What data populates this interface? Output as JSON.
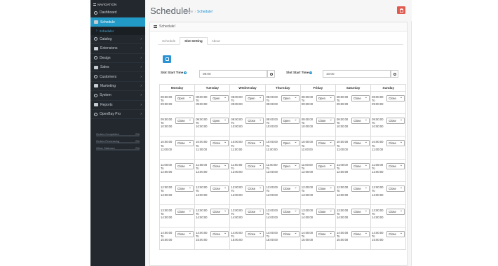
{
  "sidebar": {
    "heading": "NAVIGATION",
    "items": [
      {
        "label": "Dashboard",
        "icon": "dashboard-icon",
        "arrow": ""
      },
      {
        "label": "Schedule",
        "icon": "calendar-icon",
        "arrow": ""
      },
      {
        "label": "Catalog",
        "icon": "tag-icon",
        "arrow": "›"
      },
      {
        "label": "Extensions",
        "icon": "puzzle-icon",
        "arrow": "›"
      },
      {
        "label": "Design",
        "icon": "monitor-icon",
        "arrow": "›"
      },
      {
        "label": "Sales",
        "icon": "cart-icon",
        "arrow": "›"
      },
      {
        "label": "Customers",
        "icon": "user-icon",
        "arrow": "›"
      },
      {
        "label": "Marketing",
        "icon": "share-icon",
        "arrow": "›"
      },
      {
        "label": "System",
        "icon": "gear-icon",
        "arrow": "›"
      },
      {
        "label": "Reports",
        "icon": "chart-icon",
        "arrow": "›"
      },
      {
        "label": "OpenBay Pro",
        "icon": "openbay-icon",
        "arrow": "›"
      }
    ],
    "sub_item": "Schedule!",
    "stats": [
      {
        "label": "Orders Completed",
        "value": "0%"
      },
      {
        "label": "Orders Processing",
        "value": "0%"
      },
      {
        "label": "Other Statuses",
        "value": "0%"
      }
    ]
  },
  "header": {
    "title": "Schedule!",
    "breadcrumb": [
      "Home",
      "Schedule!"
    ],
    "delete_icon": "trash-icon",
    "delete_color": "#e15a4f"
  },
  "panel": {
    "title": "Schedule!",
    "tabs": [
      "Schedule",
      "Slot Setting",
      "About"
    ],
    "active_tab": "Slot Setting",
    "save_icon": "save-icon",
    "slot_start_label": "Slot Start Time",
    "slot_start_value": "08:00",
    "slot_end_label": "Slot Start Time",
    "slot_end_value": "10:00"
  },
  "days": [
    "Monday",
    "Tuesday",
    "Wednesday",
    "Thursday",
    "Friday",
    "Saturday",
    "Sunday"
  ],
  "slots": [
    {
      "from": "08:00:00",
      "to": "09:00:00"
    },
    {
      "from": "09:00:00",
      "to": "10:00:00"
    },
    {
      "from": "10:00:00",
      "to": "11:00:00"
    },
    {
      "from": "11:00:00",
      "to": "12:00:00"
    },
    {
      "from": "12:00:00",
      "to": "13:00:00"
    },
    {
      "from": "13:00:00",
      "to": "14:00:00"
    },
    {
      "from": "14:00:00",
      "to": "15:00:00"
    }
  ],
  "to_word": "To",
  "status": [
    [
      "Open",
      "Open",
      "Open",
      "Open",
      "Open",
      "Close",
      "Close"
    ],
    [
      "Close",
      "Open",
      "Close",
      "Open",
      "Close",
      "Close",
      "Close"
    ],
    [
      "Close",
      "Close",
      "Close",
      "Open",
      "Close",
      "Close",
      "Close"
    ],
    [
      "Close",
      "Close",
      "Close",
      "Open",
      "Open",
      "Close",
      "Close"
    ],
    [
      "Close",
      "Close",
      "Close",
      "Close",
      "Close",
      "Close",
      "Close"
    ],
    [
      "Close",
      "Close",
      "Close",
      "Close",
      "Close",
      "Close",
      "Close"
    ],
    [
      "Close",
      "Close",
      "Close",
      "Close",
      "Close",
      "Close",
      "Close"
    ]
  ]
}
